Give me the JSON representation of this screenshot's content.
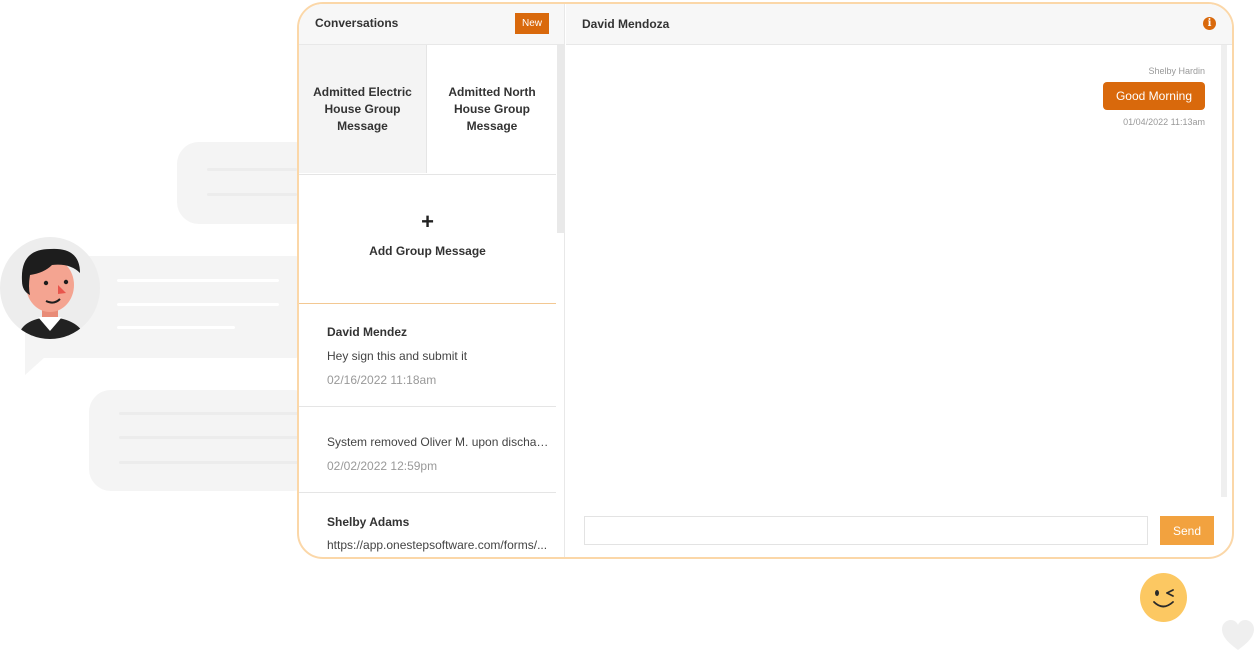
{
  "colors": {
    "accent": "#d9690c",
    "send_button": "#f2a23f",
    "window_border": "#fbd7a8",
    "emoji": "#fcc862"
  },
  "conversations_panel": {
    "title": "Conversations",
    "new_label": "New",
    "groups": [
      {
        "label": "Admitted Electric House Group Message",
        "selected": true
      },
      {
        "label": "Admitted North House Group Message",
        "selected": false
      }
    ],
    "add_group": {
      "icon": "plus-icon",
      "plus": "+",
      "label": "Add Group Message"
    },
    "items": [
      {
        "name": "David Mendez",
        "preview": "Hey sign this and submit it",
        "time": "02/16/2022 11:18am"
      },
      {
        "name": "",
        "preview": "System removed Oliver M. upon discharge",
        "time": "02/02/2022 12:59pm"
      },
      {
        "name": "Shelby Adams",
        "preview": "https://app.onestepsoftware.com/forms/...",
        "time": ""
      }
    ]
  },
  "chat": {
    "contact_name": "David Mendoza",
    "info_icon": "info-icon",
    "info_glyph": "i",
    "messages": [
      {
        "sender": "Shelby Hardin",
        "text": "Good Morning",
        "time": "01/04/2022 11:13am"
      }
    ],
    "composer": {
      "value": "",
      "send_label": "Send"
    }
  }
}
